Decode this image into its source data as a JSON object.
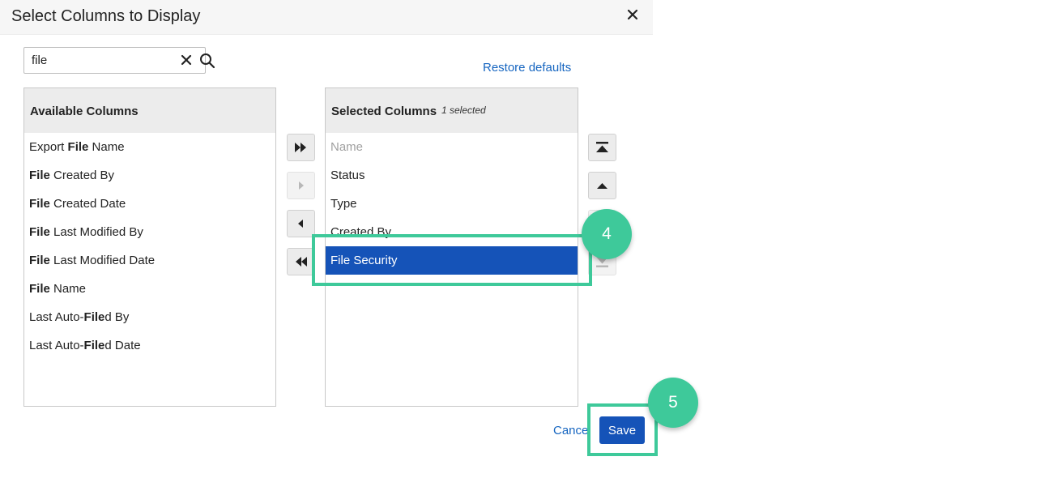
{
  "dialog": {
    "title": "Select Columns to Display",
    "close_icon": "close-icon"
  },
  "search": {
    "value": "file",
    "clear_icon": "clear-icon",
    "search_icon": "search-icon"
  },
  "restore_label": "Restore defaults",
  "available": {
    "heading": "Available Columns",
    "items": [
      {
        "pre": "Export ",
        "match": "File",
        "post": " Name"
      },
      {
        "pre": "",
        "match": "File",
        "post": " Created By"
      },
      {
        "pre": "",
        "match": "File",
        "post": " Created Date"
      },
      {
        "pre": "",
        "match": "File",
        "post": " Last Modified By"
      },
      {
        "pre": "",
        "match": "File",
        "post": " Last Modified Date"
      },
      {
        "pre": "",
        "match": "File",
        "post": " Name"
      },
      {
        "pre": "Last Auto-",
        "match": "File",
        "post": "d By"
      },
      {
        "pre": "Last Auto-",
        "match": "File",
        "post": "d Date"
      }
    ]
  },
  "selected": {
    "heading": "Selected Columns",
    "count": "1 selected",
    "items": [
      {
        "label": "Name",
        "state": "disabled"
      },
      {
        "label": "Status",
        "state": "normal"
      },
      {
        "label": "Type",
        "state": "normal"
      },
      {
        "label": "Created By",
        "state": "normal"
      },
      {
        "label": "File Security",
        "state": "selected"
      }
    ]
  },
  "transfer_buttons": [
    "move-all-right-icon",
    "move-right-icon",
    "move-left-icon",
    "move-all-left-icon"
  ],
  "order_buttons": [
    "move-to-top-icon",
    "move-up-icon",
    "move-down-icon",
    "move-to-bottom-icon"
  ],
  "footer": {
    "cancel_label": "Cancel",
    "save_label": "Save"
  },
  "callouts": {
    "step_4": "4",
    "step_5": "5",
    "accent": "#3ec99a"
  },
  "colors": {
    "primary": "#1553b8",
    "link": "#1565c0",
    "header_bg": "#ececec"
  }
}
